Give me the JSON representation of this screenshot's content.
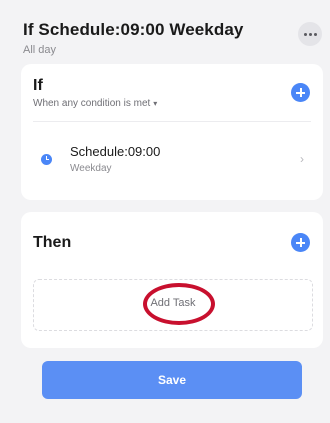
{
  "header": {
    "title": "If Schedule:09:00 Weekday",
    "subtitle": "All day"
  },
  "if_section": {
    "title": "If",
    "condition_mode": "When any condition is met",
    "conditions": [
      {
        "title": "Schedule:09:00",
        "subtitle": "Weekday",
        "icon": "clock-icon"
      }
    ]
  },
  "then_section": {
    "title": "Then",
    "add_task_label": "Add Task"
  },
  "save_label": "Save",
  "colors": {
    "accent": "#4a86f7",
    "save": "#5b8ff4",
    "highlight": "#c8102e"
  }
}
